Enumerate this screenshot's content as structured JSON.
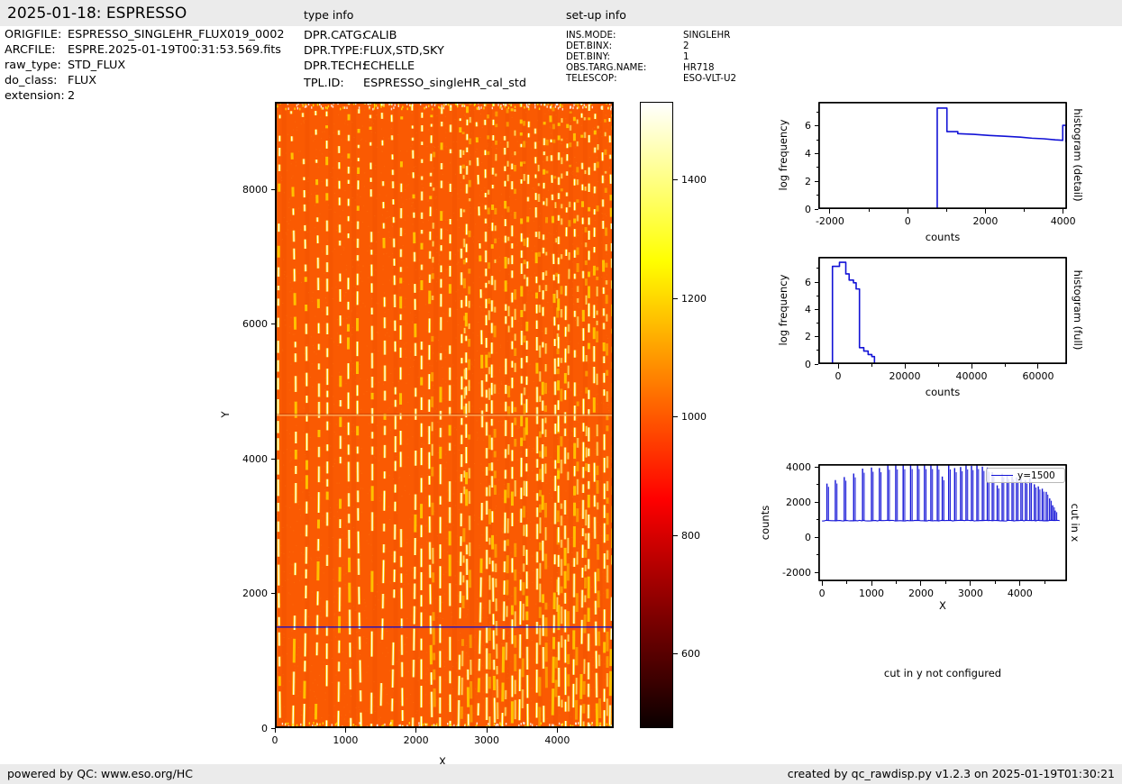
{
  "header": {
    "title": "2025-01-18: ESPRESSO",
    "type_info_title": "type info",
    "setup_info_title": "set-up info"
  },
  "file_info": {
    "rows": [
      {
        "label": "ORIGFILE:",
        "value": "ESPRESSO_SINGLEHR_FLUX019_0002"
      },
      {
        "label": "ARCFILE:",
        "value": "ESPRE.2025-01-19T00:31:53.569.fits"
      },
      {
        "label": "raw_type:",
        "value": "STD_FLUX"
      },
      {
        "label": "do_class:",
        "value": "FLUX"
      },
      {
        "label": "extension:",
        "value": "2"
      }
    ]
  },
  "type_info": {
    "rows": [
      {
        "label": "DPR.CATG:",
        "value": "CALIB"
      },
      {
        "label": "DPR.TYPE:",
        "value": "FLUX,STD,SKY"
      },
      {
        "label": "DPR.TECH:",
        "value": "ECHELLE"
      },
      {
        "label": "TPL.ID:",
        "value": "ESPRESSO_singleHR_cal_std"
      }
    ]
  },
  "setup_info": {
    "rows": [
      {
        "label": "INS.MODE:",
        "value": "SINGLEHR"
      },
      {
        "label": "DET.BINX:",
        "value": "2"
      },
      {
        "label": "DET.BINY:",
        "value": "1"
      },
      {
        "label": "OBS.TARG.NAME:",
        "value": "HR718"
      },
      {
        "label": "TELESCOP:",
        "value": "ESO-VLT-U2"
      }
    ]
  },
  "cut_in_y_note": "cut in y not configured",
  "footer": {
    "left": "powered by QC: www.eso.org/HC",
    "right": "created by qc_rawdisp.py v1.2.3 on 2025-01-19T01:30:21"
  },
  "ui_colors": {
    "band": "#ebebeb",
    "line_blue": "#1212d6",
    "image_base": "#fa5a02"
  },
  "chart_data": [
    {
      "id": "raw_image",
      "type": "heatmap",
      "xlabel": "X",
      "ylabel": "Y",
      "xlim": [
        0,
        4800
      ],
      "ylim": [
        0,
        9300
      ],
      "x_ticks": [
        0,
        1000,
        2000,
        3000,
        4000
      ],
      "y_ticks": [
        0,
        2000,
        4000,
        6000,
        8000
      ],
      "cut_line_y": 1500,
      "chip_gap_y": 4650,
      "colormap": "hot",
      "background_value": 1000,
      "n_orders_approx": 36,
      "base_color": "#fa5a02",
      "order_glow_color": "#ffd400",
      "order_core_color": "#ffffff",
      "cut_line_color": "#0008d8",
      "colorbar": {
        "vmin": 475,
        "vmax": 1532,
        "ticks": [
          600,
          800,
          1000,
          1200,
          1400
        ]
      }
    },
    {
      "id": "histogram_detail",
      "type": "line",
      "side_label": "histogram (detail)",
      "xlabel": "counts",
      "ylabel": "log frequency",
      "xlim": [
        -2300,
        4100
      ],
      "ylim": [
        0,
        7.75
      ],
      "x_ticks": [
        -2000,
        0,
        2000,
        4000
      ],
      "x_minor_ticks": [
        -1000,
        1000,
        3000
      ],
      "y_ticks": [
        0,
        2,
        4,
        6
      ],
      "y_minor_ticks": [
        1,
        3,
        5,
        7
      ],
      "color": "#1212d6",
      "points": [
        [
          -2300,
          0
        ],
        [
          760,
          0
        ],
        [
          760,
          7.3
        ],
        [
          1010,
          7.3
        ],
        [
          1010,
          5.6
        ],
        [
          1290,
          5.6
        ],
        [
          1290,
          5.45
        ],
        [
          1700,
          5.4
        ],
        [
          2100,
          5.32
        ],
        [
          2500,
          5.26
        ],
        [
          2900,
          5.2
        ],
        [
          3200,
          5.12
        ],
        [
          3500,
          5.08
        ],
        [
          3800,
          5.0
        ],
        [
          3990,
          4.97
        ],
        [
          3990,
          6.05
        ],
        [
          4070,
          6.05
        ],
        [
          4070,
          4.88
        ],
        [
          4100,
          4.88
        ]
      ]
    },
    {
      "id": "histogram_full",
      "type": "line",
      "side_label": "histogram (full)",
      "xlabel": "counts",
      "ylabel": "log frequency",
      "xlim": [
        -5950,
        68650
      ],
      "ylim": [
        0,
        7.85
      ],
      "x_ticks": [
        0,
        20000,
        40000,
        60000
      ],
      "x_minor_ticks": [
        10000,
        30000,
        50000
      ],
      "y_ticks": [
        0,
        2,
        4,
        6
      ],
      "y_minor_ticks": [
        1,
        3,
        5,
        7
      ],
      "color": "#1212d6",
      "points": [
        [
          -5950,
          0
        ],
        [
          -1700,
          0
        ],
        [
          -1700,
          7.15
        ],
        [
          400,
          7.15
        ],
        [
          400,
          7.45
        ],
        [
          2300,
          7.45
        ],
        [
          2300,
          6.6
        ],
        [
          3300,
          6.6
        ],
        [
          3300,
          6.15
        ],
        [
          4600,
          6.15
        ],
        [
          4600,
          5.95
        ],
        [
          5400,
          5.95
        ],
        [
          5400,
          5.5
        ],
        [
          6400,
          5.5
        ],
        [
          6400,
          1.2
        ],
        [
          7700,
          1.2
        ],
        [
          7700,
          0.95
        ],
        [
          9000,
          0.95
        ],
        [
          9000,
          0.7
        ],
        [
          10100,
          0.7
        ],
        [
          10100,
          0.55
        ],
        [
          10900,
          0.55
        ],
        [
          10900,
          0
        ],
        [
          68650,
          0
        ]
      ]
    },
    {
      "id": "cut_in_x",
      "type": "line",
      "side_label": "cut in x",
      "xlabel": "X",
      "ylabel": "counts",
      "xlim": [
        -75,
        4950
      ],
      "ylim": [
        -2485,
        4155
      ],
      "x_ticks": [
        0,
        1000,
        2000,
        3000,
        4000
      ],
      "x_minor_ticks": [
        500,
        1500,
        2500,
        3500,
        4500
      ],
      "y_ticks": [
        -2000,
        0,
        2000,
        4000
      ],
      "y_minor_ticks": [
        -1000,
        1000,
        3000
      ],
      "legend_label": "y=1500",
      "color": "#1212d6",
      "baseline": 950,
      "spikes": [
        [
          100,
          3050
        ],
        [
          270,
          3250
        ],
        [
          450,
          3420
        ],
        [
          640,
          3620
        ],
        [
          820,
          3900
        ],
        [
          1000,
          3960
        ],
        [
          1160,
          3930
        ],
        [
          1330,
          4080
        ],
        [
          1490,
          4100
        ],
        [
          1640,
          4110
        ],
        [
          1790,
          4120
        ],
        [
          1930,
          4120
        ],
        [
          2070,
          4120
        ],
        [
          2200,
          4120
        ],
        [
          2330,
          4090
        ],
        [
          2430,
          3450
        ],
        [
          2560,
          4100
        ],
        [
          2680,
          3930
        ],
        [
          2800,
          3990
        ],
        [
          2910,
          4100
        ],
        [
          3020,
          4060
        ],
        [
          3130,
          4120
        ],
        [
          3240,
          4010
        ],
        [
          3340,
          3960
        ],
        [
          3440,
          3700
        ],
        [
          3540,
          2950
        ],
        [
          3640,
          3620
        ],
        [
          3740,
          3520
        ],
        [
          3840,
          3480
        ],
        [
          3930,
          3400
        ],
        [
          4020,
          3330
        ],
        [
          4110,
          3250
        ],
        [
          4200,
          3350
        ],
        [
          4290,
          3010
        ],
        [
          4370,
          2890
        ],
        [
          4450,
          2760
        ],
        [
          4530,
          2580
        ],
        [
          4600,
          2210
        ],
        [
          4660,
          1820
        ],
        [
          4710,
          1520
        ]
      ]
    }
  ]
}
